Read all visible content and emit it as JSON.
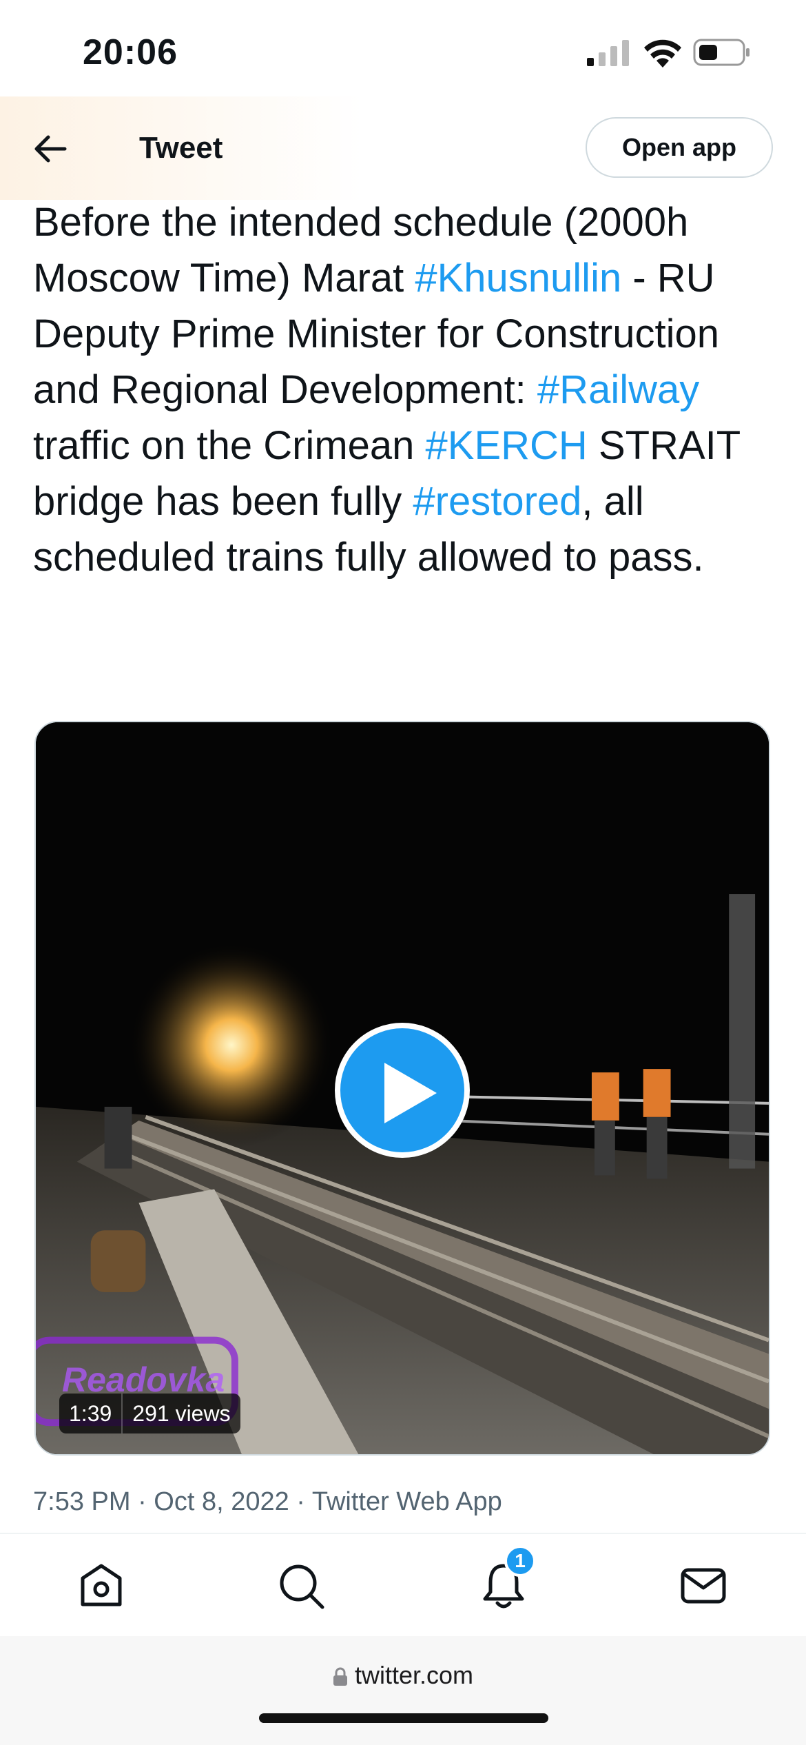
{
  "status_bar": {
    "time": "20:06"
  },
  "header": {
    "title": "Tweet",
    "open_app_label": "Open app",
    "back_icon": "arrow-left-icon"
  },
  "tweet": {
    "segments": [
      {
        "text": "Before the intended schedule (2000h Moscow Time) Marat ",
        "hashtag": false
      },
      {
        "text": "#Khusnullin",
        "hashtag": true
      },
      {
        "text": " - RU Deputy Prime Minister for Construction and Regional Development: ",
        "hashtag": false
      },
      {
        "text": "#Railway",
        "hashtag": true
      },
      {
        "text": " traffic on the Crimean ",
        "hashtag": false
      },
      {
        "text": "#KERCH",
        "hashtag": true
      },
      {
        "text": " STRAIT bridge has been fully ",
        "hashtag": false
      },
      {
        "text": "#restored",
        "hashtag": true
      },
      {
        "text": ", all scheduled trains fully allowed to pass.",
        "hashtag": false
      }
    ],
    "video": {
      "duration": "1:39",
      "views": "291 views",
      "watermark": "Readovka"
    },
    "meta": "7:53 PM · Oct 8, 2022 · Twitter Web App"
  },
  "tabbar": {
    "items": [
      "home-icon",
      "search-icon",
      "notifications-icon",
      "messages-icon"
    ],
    "notification_badge": "1"
  },
  "browser": {
    "url": "twitter.com"
  },
  "colors": {
    "accent": "#1d9bf0",
    "text": "#0f1419",
    "muted": "#536471"
  }
}
